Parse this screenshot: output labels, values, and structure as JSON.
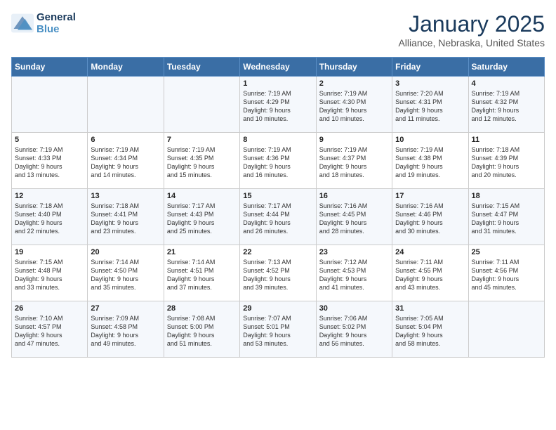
{
  "header": {
    "logo_line1": "General",
    "logo_line2": "Blue",
    "month": "January 2025",
    "location": "Alliance, Nebraska, United States"
  },
  "weekdays": [
    "Sunday",
    "Monday",
    "Tuesday",
    "Wednesday",
    "Thursday",
    "Friday",
    "Saturday"
  ],
  "weeks": [
    [
      {
        "day": "",
        "info": ""
      },
      {
        "day": "",
        "info": ""
      },
      {
        "day": "",
        "info": ""
      },
      {
        "day": "1",
        "info": "Sunrise: 7:19 AM\nSunset: 4:29 PM\nDaylight: 9 hours\nand 10 minutes."
      },
      {
        "day": "2",
        "info": "Sunrise: 7:19 AM\nSunset: 4:30 PM\nDaylight: 9 hours\nand 10 minutes."
      },
      {
        "day": "3",
        "info": "Sunrise: 7:20 AM\nSunset: 4:31 PM\nDaylight: 9 hours\nand 11 minutes."
      },
      {
        "day": "4",
        "info": "Sunrise: 7:19 AM\nSunset: 4:32 PM\nDaylight: 9 hours\nand 12 minutes."
      }
    ],
    [
      {
        "day": "5",
        "info": "Sunrise: 7:19 AM\nSunset: 4:33 PM\nDaylight: 9 hours\nand 13 minutes."
      },
      {
        "day": "6",
        "info": "Sunrise: 7:19 AM\nSunset: 4:34 PM\nDaylight: 9 hours\nand 14 minutes."
      },
      {
        "day": "7",
        "info": "Sunrise: 7:19 AM\nSunset: 4:35 PM\nDaylight: 9 hours\nand 15 minutes."
      },
      {
        "day": "8",
        "info": "Sunrise: 7:19 AM\nSunset: 4:36 PM\nDaylight: 9 hours\nand 16 minutes."
      },
      {
        "day": "9",
        "info": "Sunrise: 7:19 AM\nSunset: 4:37 PM\nDaylight: 9 hours\nand 18 minutes."
      },
      {
        "day": "10",
        "info": "Sunrise: 7:19 AM\nSunset: 4:38 PM\nDaylight: 9 hours\nand 19 minutes."
      },
      {
        "day": "11",
        "info": "Sunrise: 7:18 AM\nSunset: 4:39 PM\nDaylight: 9 hours\nand 20 minutes."
      }
    ],
    [
      {
        "day": "12",
        "info": "Sunrise: 7:18 AM\nSunset: 4:40 PM\nDaylight: 9 hours\nand 22 minutes."
      },
      {
        "day": "13",
        "info": "Sunrise: 7:18 AM\nSunset: 4:41 PM\nDaylight: 9 hours\nand 23 minutes."
      },
      {
        "day": "14",
        "info": "Sunrise: 7:17 AM\nSunset: 4:43 PM\nDaylight: 9 hours\nand 25 minutes."
      },
      {
        "day": "15",
        "info": "Sunrise: 7:17 AM\nSunset: 4:44 PM\nDaylight: 9 hours\nand 26 minutes."
      },
      {
        "day": "16",
        "info": "Sunrise: 7:16 AM\nSunset: 4:45 PM\nDaylight: 9 hours\nand 28 minutes."
      },
      {
        "day": "17",
        "info": "Sunrise: 7:16 AM\nSunset: 4:46 PM\nDaylight: 9 hours\nand 30 minutes."
      },
      {
        "day": "18",
        "info": "Sunrise: 7:15 AM\nSunset: 4:47 PM\nDaylight: 9 hours\nand 31 minutes."
      }
    ],
    [
      {
        "day": "19",
        "info": "Sunrise: 7:15 AM\nSunset: 4:48 PM\nDaylight: 9 hours\nand 33 minutes."
      },
      {
        "day": "20",
        "info": "Sunrise: 7:14 AM\nSunset: 4:50 PM\nDaylight: 9 hours\nand 35 minutes."
      },
      {
        "day": "21",
        "info": "Sunrise: 7:14 AM\nSunset: 4:51 PM\nDaylight: 9 hours\nand 37 minutes."
      },
      {
        "day": "22",
        "info": "Sunrise: 7:13 AM\nSunset: 4:52 PM\nDaylight: 9 hours\nand 39 minutes."
      },
      {
        "day": "23",
        "info": "Sunrise: 7:12 AM\nSunset: 4:53 PM\nDaylight: 9 hours\nand 41 minutes."
      },
      {
        "day": "24",
        "info": "Sunrise: 7:11 AM\nSunset: 4:55 PM\nDaylight: 9 hours\nand 43 minutes."
      },
      {
        "day": "25",
        "info": "Sunrise: 7:11 AM\nSunset: 4:56 PM\nDaylight: 9 hours\nand 45 minutes."
      }
    ],
    [
      {
        "day": "26",
        "info": "Sunrise: 7:10 AM\nSunset: 4:57 PM\nDaylight: 9 hours\nand 47 minutes."
      },
      {
        "day": "27",
        "info": "Sunrise: 7:09 AM\nSunset: 4:58 PM\nDaylight: 9 hours\nand 49 minutes."
      },
      {
        "day": "28",
        "info": "Sunrise: 7:08 AM\nSunset: 5:00 PM\nDaylight: 9 hours\nand 51 minutes."
      },
      {
        "day": "29",
        "info": "Sunrise: 7:07 AM\nSunset: 5:01 PM\nDaylight: 9 hours\nand 53 minutes."
      },
      {
        "day": "30",
        "info": "Sunrise: 7:06 AM\nSunset: 5:02 PM\nDaylight: 9 hours\nand 56 minutes."
      },
      {
        "day": "31",
        "info": "Sunrise: 7:05 AM\nSunset: 5:04 PM\nDaylight: 9 hours\nand 58 minutes."
      },
      {
        "day": "",
        "info": ""
      }
    ]
  ]
}
